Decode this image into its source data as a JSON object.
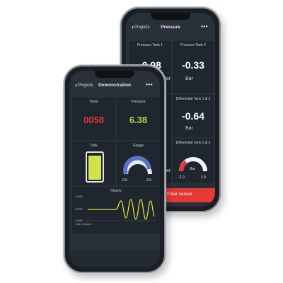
{
  "back_phone": {
    "nav": {
      "back_label": "Projects",
      "title": "Pressure",
      "more": "•••"
    },
    "tiles": [
      {
        "label": "Pressure Tank 1",
        "value": "-0.98",
        "unit": "Bar"
      },
      {
        "label": "Pressure Tank 2",
        "value": "-0.33",
        "unit": "Bar"
      },
      {
        "label": "Differential Tank 1 & 2",
        "value": "-0.64",
        "unit": "Bar"
      },
      {
        "label": "Differential Tank 2 & 3",
        "gauge_min": "-2.0",
        "gauge_max": "2.0",
        "gauge_unit": "Bar",
        "unit": "Bar"
      }
    ],
    "alert": {
      "text": "0 bar sensor",
      "color": "#e53935"
    }
  },
  "front_phone": {
    "nav": {
      "back_label": "Projects",
      "title": "Demonstration",
      "more": "•••"
    },
    "timer": {
      "label": "Timer",
      "value": "0058",
      "color": "#e53238"
    },
    "pressure": {
      "label": "Pressure",
      "value": "6.38",
      "color": "#a6d84a"
    },
    "tank": {
      "label": "Tank",
      "fill_color": "#d4e24a",
      "fill_level": 0.9
    },
    "gauge": {
      "label": "Gauge",
      "min": "0.0",
      "max": "2.0",
      "color": "#5a73c9"
    },
    "history": {
      "label": "History",
      "y_labels": [
        "2.1005",
        "2.0000",
        "0.1852"
      ],
      "x_label": "1 min, 40 secs",
      "line_color": "#e9e63a"
    }
  }
}
